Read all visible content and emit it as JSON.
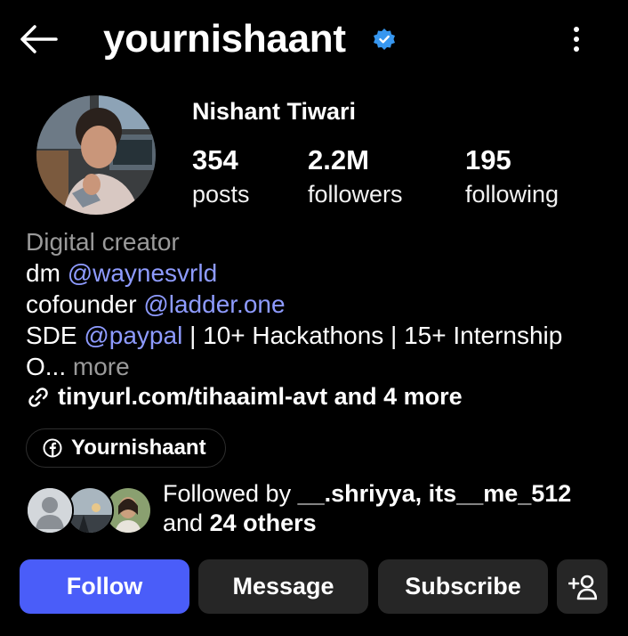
{
  "header": {
    "username": "yournishaant",
    "icons": [
      "back-arrow-icon",
      "verified-badge-icon",
      "more-vertical-icon"
    ]
  },
  "profile": {
    "full_name": "Nishant Tiwari",
    "stats": [
      {
        "value": "354",
        "label": "posts"
      },
      {
        "value": "2.2M",
        "label": "followers"
      },
      {
        "value": "195",
        "label": "following"
      }
    ]
  },
  "bio": {
    "category": "Digital creator",
    "line1_prefix": "dm ",
    "line1_mention": "@waynesvrld",
    "line2_prefix": "cofounder ",
    "line2_mention": "@ladder.one",
    "line3_prefix": "SDE ",
    "line3_mention": "@paypal",
    "line3_suffix": " | 10+ Hackathons | 15+ Internship",
    "line4_text": "O...",
    "more": "more"
  },
  "link": {
    "text": "tinyurl.com/tihaaiml-avt and 4 more",
    "icon": "link-icon"
  },
  "facebook_chip": {
    "label": "Yournishaant",
    "icon": "facebook-icon"
  },
  "followed_by": {
    "prefix": "Followed by ",
    "names": "__.shriyya, its__me_512",
    "and": "and ",
    "others": "24 others"
  },
  "actions": {
    "follow": "Follow",
    "message": "Message",
    "subscribe": "Subscribe",
    "suggest_icon": "add-person-icon"
  },
  "colors": {
    "accent": "#4a5df9",
    "mention": "#8e9bff",
    "verified": "#3797f0",
    "background": "#000000",
    "secondary_button": "#262626"
  }
}
